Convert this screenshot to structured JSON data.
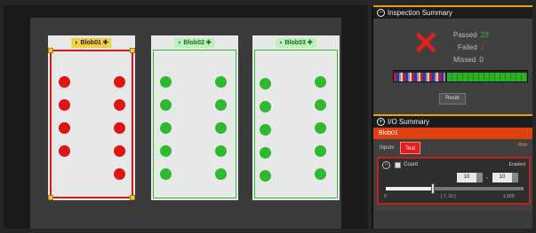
{
  "view": {
    "blobs": [
      {
        "label": "Blob01",
        "status": "fail"
      },
      {
        "label": "Blob02",
        "status": "pass"
      },
      {
        "label": "Blob03",
        "status": "pass"
      }
    ]
  },
  "inspection": {
    "title": "Inspection Summary",
    "passed_label": "Passed",
    "passed_value": "23",
    "failed_label": "Failed",
    "failed_value": "1",
    "missed_label": "Missed",
    "missed_value": "0",
    "reset_label": "Reset"
  },
  "io": {
    "title": "I/O Summary",
    "selected_tool": "Blob01",
    "tabs": [
      "Inputs",
      "Test"
    ],
    "active_tab": "Test",
    "panel_label": "Blob",
    "tool": {
      "name": "Count",
      "enabled_label": "Enabled",
      "min_value": "10",
      "max_value": "10",
      "range_min": "0",
      "range_mid": "[ 7, 10 ]",
      "range_max": "1,000",
      "slider_fraction": 0.34
    }
  },
  "colors": {
    "fail": "#e11414",
    "pass": "#2dbb2d",
    "accent": "#f0a000"
  }
}
